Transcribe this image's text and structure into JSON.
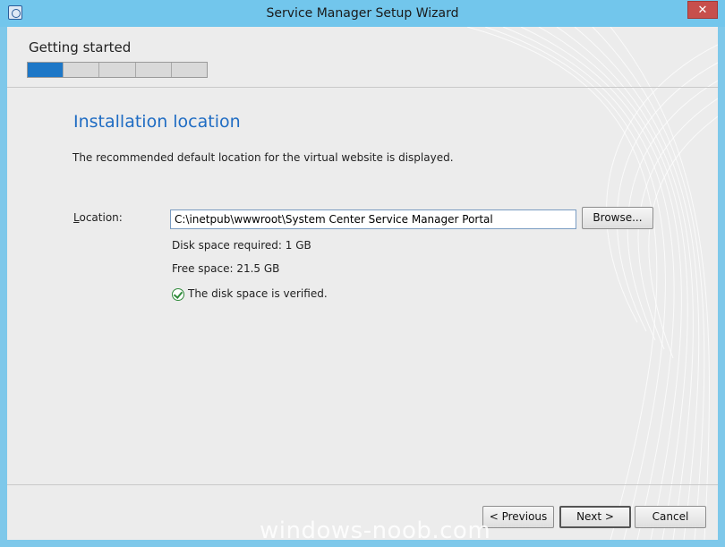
{
  "window": {
    "title": "Service Manager Setup Wizard",
    "close_label": "✕"
  },
  "wizard": {
    "step_title": "Getting started",
    "progress": {
      "total_steps": 5,
      "current_step": 1
    }
  },
  "page": {
    "heading": "Installation location",
    "description": "The recommended default location for the virtual website is displayed.",
    "location": {
      "label_prefix": "L",
      "label_rest": "ocation:",
      "value": "C:\\inetpub\\wwwroot\\System Center Service Manager Portal"
    },
    "browse_label": "Browse...",
    "disk_space_required": "Disk space required: 1 GB",
    "free_space": "Free space: 21.5 GB",
    "verified_message": "The disk space is verified."
  },
  "footer": {
    "previous_label": "< Previous",
    "next_label": "Next >",
    "cancel_label": "Cancel"
  },
  "watermark": "windows-noob.com",
  "colors": {
    "title_bar": "#72c6ec",
    "accent_heading": "#1f6cc3",
    "progress_active": "#1d77c7",
    "close_button": "#c74f4c",
    "success": "#2f8a3a"
  }
}
